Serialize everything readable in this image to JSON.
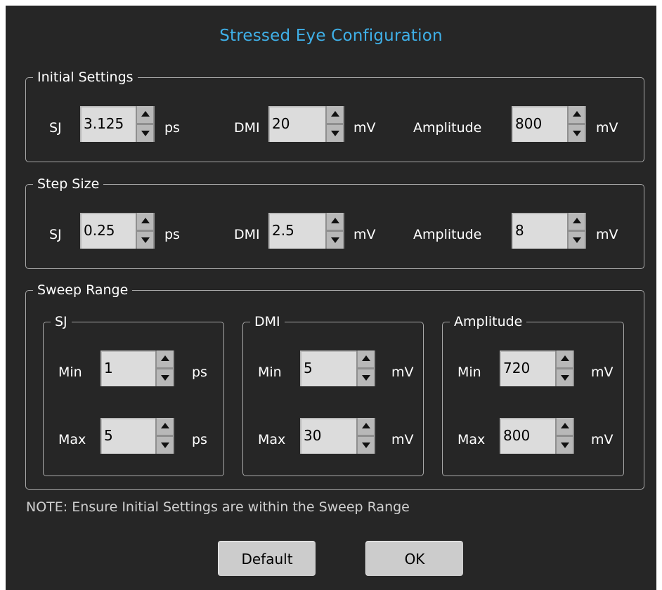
{
  "dialog": {
    "title": "Stressed Eye Configuration",
    "note": "NOTE: Ensure Initial Settings are within the Sweep Range"
  },
  "initial_settings": {
    "legend": "Initial Settings",
    "sj": {
      "label": "SJ",
      "value": "3.125",
      "unit": "ps"
    },
    "dmi": {
      "label": "DMI",
      "value": "20",
      "unit": "mV"
    },
    "amplitude": {
      "label": "Amplitude",
      "value": "800",
      "unit": "mV"
    }
  },
  "step_size": {
    "legend": "Step Size",
    "sj": {
      "label": "SJ",
      "value": "0.25",
      "unit": "ps"
    },
    "dmi": {
      "label": "DMI",
      "value": "2.5",
      "unit": "mV"
    },
    "amplitude": {
      "label": "Amplitude",
      "value": "8",
      "unit": "mV"
    }
  },
  "sweep_range": {
    "legend": "Sweep Range",
    "min_label": "Min",
    "max_label": "Max",
    "sj": {
      "legend": "SJ",
      "min": "1",
      "max": "5",
      "unit": "ps"
    },
    "dmi": {
      "legend": "DMI",
      "min": "5",
      "max": "30",
      "unit": "mV"
    },
    "amplitude": {
      "legend": "Amplitude",
      "min": "720",
      "max": "800",
      "unit": "mV"
    }
  },
  "buttons": {
    "default_label": "Default",
    "ok_label": "OK"
  },
  "colors": {
    "background": "#262626",
    "title": "#3fb0e8",
    "field": "#dcdcdc",
    "button": "#cccccc"
  }
}
